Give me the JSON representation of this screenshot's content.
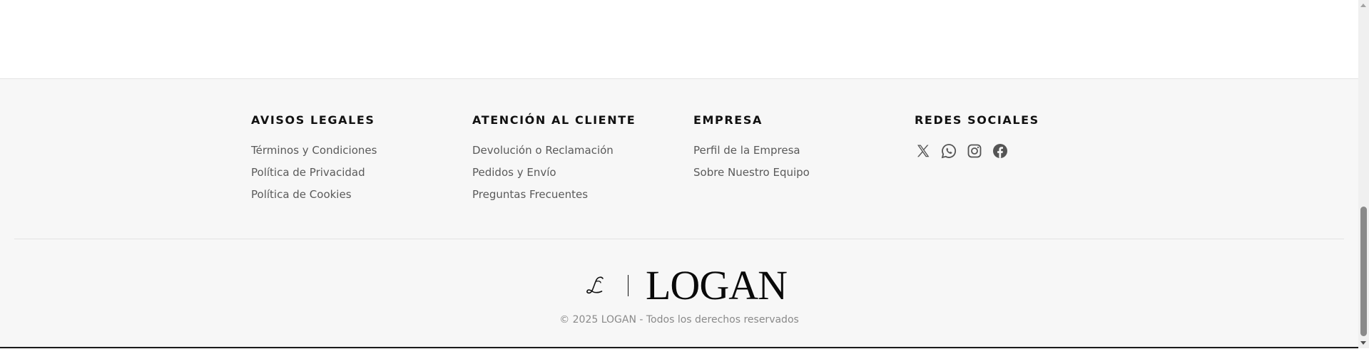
{
  "footer": {
    "columns": [
      {
        "heading": "AVISOS LEGALES",
        "links": [
          "Términos y Condiciones",
          "Política de Privacidad",
          "Política de Cookies"
        ]
      },
      {
        "heading": "ATENCIÓN AL CLIENTE",
        "links": [
          "Devolución o Reclamación",
          "Pedidos y Envío",
          "Preguntas Frecuentes"
        ]
      },
      {
        "heading": "EMPRESA",
        "links": [
          "Perfil de la Empresa",
          "Sobre Nuestro Equipo"
        ]
      },
      {
        "heading": "REDES SOCIALES",
        "social_icons": [
          "x-icon",
          "whatsapp-icon",
          "instagram-icon",
          "facebook-icon"
        ]
      }
    ],
    "logo": {
      "wordmark": "LOGAN",
      "monogram": "L"
    },
    "copyright": "© 2025 LOGAN - Todos los derechos reservados"
  },
  "colors": {
    "footer_background": "#f7f7f7",
    "heading_text": "#111111",
    "link_text": "#5a5a5a",
    "icon": "#555555",
    "copyright_text": "#8a8a8a"
  }
}
